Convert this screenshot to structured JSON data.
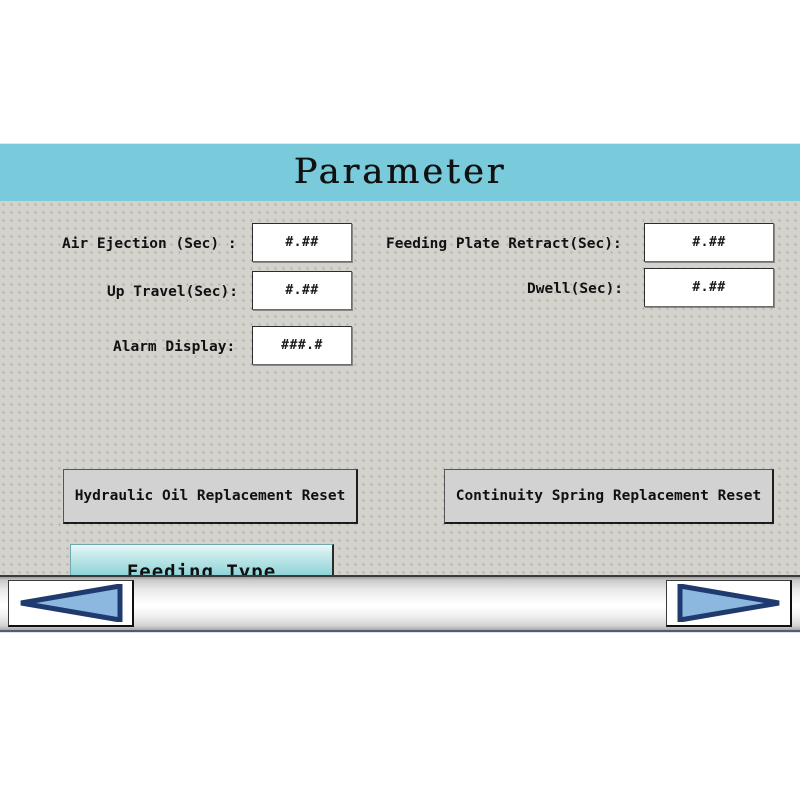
{
  "panel": {
    "title": "Parameter",
    "title_bar_color": "#79cbdb",
    "body_color": "#d3d2cd"
  },
  "fields": [
    {
      "key": "air_ejection",
      "label": "Air Ejection (Sec) :",
      "value": "#.##",
      "column": "left"
    },
    {
      "key": "feeding_plate_retract",
      "label": "Feeding Plate Retract(Sec):",
      "value": "#.##",
      "column": "right"
    },
    {
      "key": "up_travel",
      "label": "Up Travel(Sec):",
      "value": "#.##",
      "column": "left"
    },
    {
      "key": "dwell",
      "label": "Dwell(Sec):",
      "value": "#.##",
      "column": "right"
    },
    {
      "key": "alarm_display",
      "label": "Alarm Display:",
      "value": "###.#",
      "column": "left"
    }
  ],
  "buttons": {
    "hydraulic_oil_reset": "Hydraulic Oil Replacement Reset",
    "continuity_spring_reset": "Continuity Spring Replacement Reset",
    "feeding_type": "Feeding Type",
    "feeding_type_color": "#45b9be"
  },
  "navigation": {
    "prev_icon": "triangle-left-icon",
    "next_icon": "triangle-right-icon",
    "arrow_fill": "#8cb8e0",
    "arrow_stroke": "#1f3a6e"
  }
}
